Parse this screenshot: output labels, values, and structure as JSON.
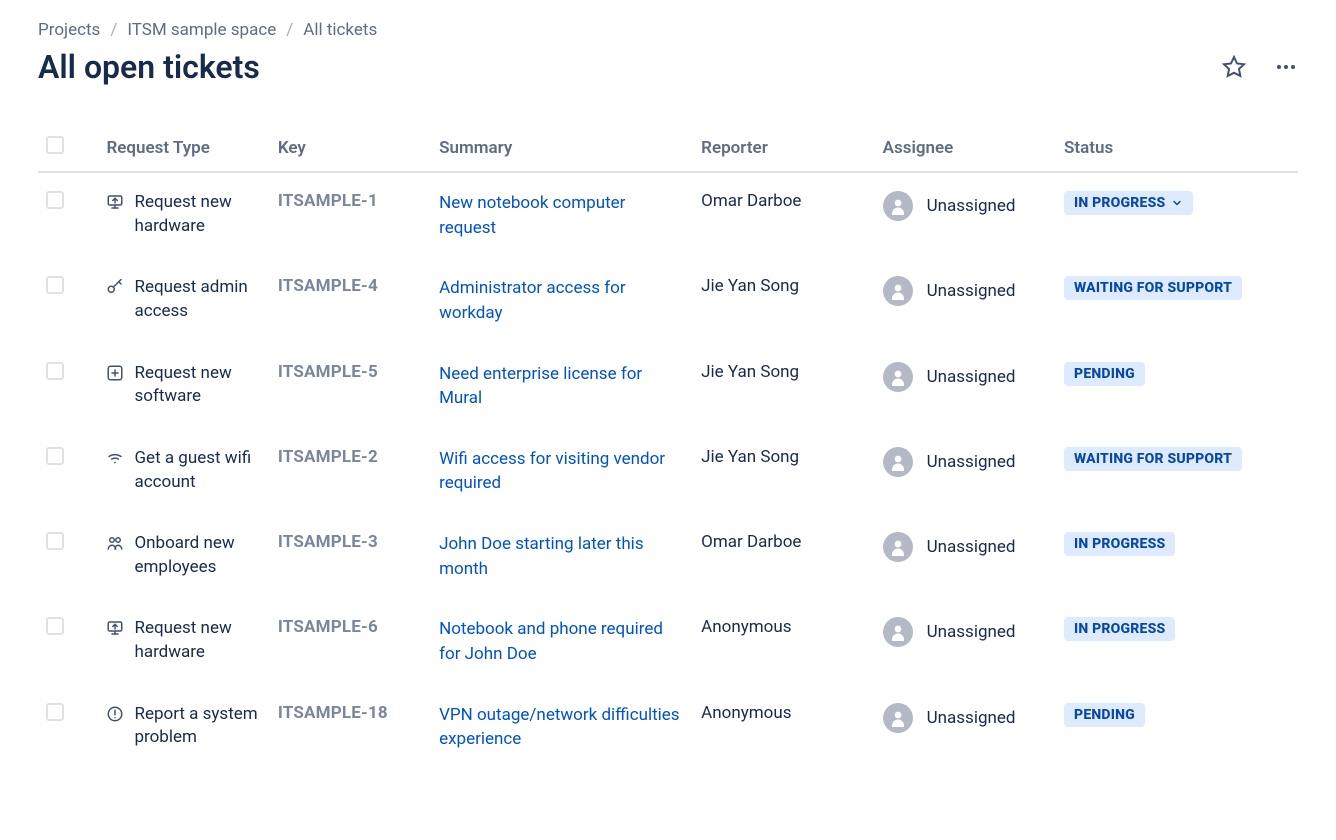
{
  "breadcrumb": {
    "projects": "Projects",
    "space": "ITSM sample space",
    "current": "All tickets"
  },
  "page_title": "All open tickets",
  "columns": {
    "request_type": "Request Type",
    "key": "Key",
    "summary": "Summary",
    "reporter": "Reporter",
    "assignee": "Assignee",
    "status": "Status"
  },
  "tickets": [
    {
      "request_type": "Request new hardware",
      "icon": "monitor-up",
      "key": "ITSAMPLE-1",
      "summary": "New notebook computer request",
      "reporter": "Omar Darboe",
      "assignee": "Unassigned",
      "status": "IN PROGRESS",
      "status_has_chevron": true
    },
    {
      "request_type": "Request admin access",
      "icon": "key",
      "key": "ITSAMPLE-4",
      "summary": "Administrator access for workday",
      "reporter": "Jie Yan Song",
      "assignee": "Unassigned",
      "status": "WAITING FOR SUPPORT",
      "status_has_chevron": false
    },
    {
      "request_type": "Request new software",
      "icon": "plus-box",
      "key": "ITSAMPLE-5",
      "summary": "Need enterprise license for Mural",
      "reporter": "Jie Yan Song",
      "assignee": "Unassigned",
      "status": "PENDING",
      "status_has_chevron": false
    },
    {
      "request_type": "Get a guest wifi account",
      "icon": "wifi",
      "key": "ITSAMPLE-2",
      "summary": "Wifi access for visiting vendor required",
      "reporter": "Jie Yan Song",
      "assignee": "Unassigned",
      "status": "WAITING FOR SUPPORT",
      "status_has_chevron": false
    },
    {
      "request_type": "Onboard new employees",
      "icon": "people",
      "key": "ITSAMPLE-3",
      "summary": "John Doe starting later this month",
      "reporter": "Omar Darboe",
      "assignee": "Unassigned",
      "status": "IN PROGRESS",
      "status_has_chevron": false
    },
    {
      "request_type": "Request new hardware",
      "icon": "monitor-up",
      "key": "ITSAMPLE-6",
      "summary": "Notebook and phone required for John Doe",
      "reporter": "Anonymous",
      "assignee": "Unassigned",
      "status": "IN PROGRESS",
      "status_has_chevron": false
    },
    {
      "request_type": "Report a system problem",
      "icon": "alert",
      "key": "ITSAMPLE-18",
      "summary": "VPN outage/network difficulties experience",
      "reporter": "Anonymous",
      "assignee": "Unassigned",
      "status": "PENDING",
      "status_has_chevron": false
    }
  ]
}
